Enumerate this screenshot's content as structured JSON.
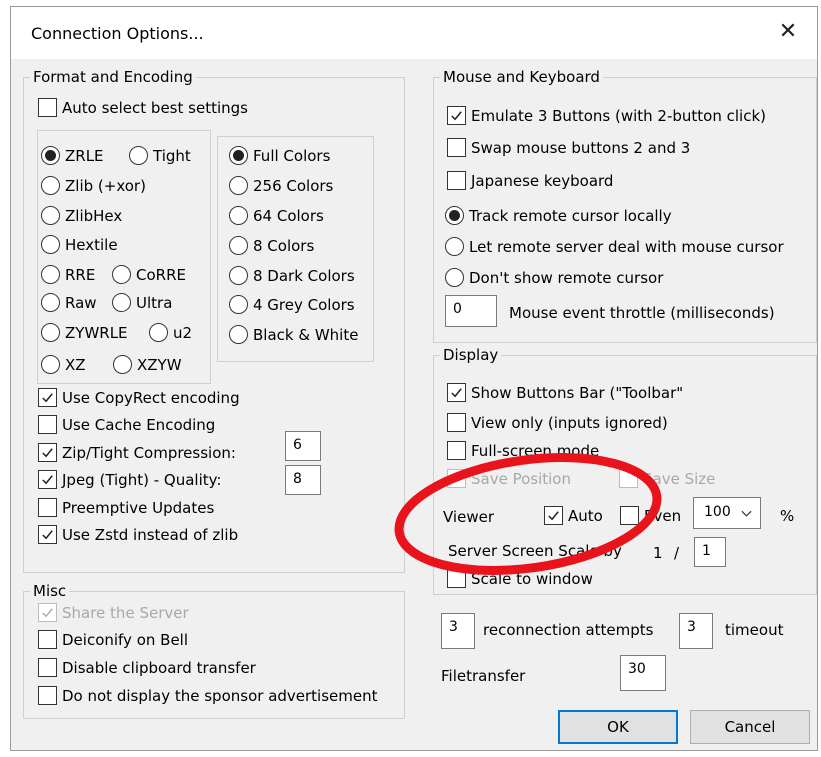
{
  "window": {
    "title": "Connection Options...",
    "close_glyph": "✕"
  },
  "format": {
    "legend": "Format and Encoding",
    "auto_select": {
      "label": "Auto select best settings",
      "checked": false
    },
    "encodings": [
      {
        "label": "ZRLE",
        "selected": true
      },
      {
        "label": "Tight",
        "selected": false
      },
      {
        "label": "Zlib (+xor)",
        "selected": false
      },
      {
        "label": "ZlibHex",
        "selected": false
      },
      {
        "label": "Hextile",
        "selected": false
      },
      {
        "label": "RRE",
        "selected": false
      },
      {
        "label": "CoRRE",
        "selected": false
      },
      {
        "label": "Raw",
        "selected": false
      },
      {
        "label": "Ultra",
        "selected": false
      },
      {
        "label": "ZYWRLE",
        "selected": false
      },
      {
        "label": "u2",
        "selected": false
      },
      {
        "label": "XZ",
        "selected": false
      },
      {
        "label": "XZYW",
        "selected": false
      }
    ],
    "colors": [
      {
        "label": "Full Colors",
        "selected": true
      },
      {
        "label": "256 Colors",
        "selected": false
      },
      {
        "label": "64 Colors",
        "selected": false
      },
      {
        "label": "8 Colors",
        "selected": false
      },
      {
        "label": "8 Dark Colors",
        "selected": false
      },
      {
        "label": "4 Grey Colors",
        "selected": false
      },
      {
        "label": "Black & White",
        "selected": false
      }
    ],
    "use_copyrect": {
      "label": "Use CopyRect encoding",
      "checked": true
    },
    "use_cache": {
      "label": "Use Cache Encoding",
      "checked": false
    },
    "zip_tight": {
      "label": "Zip/Tight Compression:",
      "checked": true,
      "value": "6"
    },
    "jpeg": {
      "label": "Jpeg (Tight) - Quality:",
      "checked": true,
      "value": "8"
    },
    "preemptive": {
      "label": "Preemptive Updates",
      "checked": false
    },
    "zstd": {
      "label": "Use Zstd instead of zlib",
      "checked": true
    }
  },
  "misc": {
    "legend": "Misc",
    "share": {
      "label": "Share the Server",
      "checked": true,
      "disabled": true
    },
    "deiconify": {
      "label": "Deiconify on Bell",
      "checked": false
    },
    "disable_clipboard": {
      "label": "Disable clipboard transfer",
      "checked": false
    },
    "no_sponsor": {
      "label": "Do not display the sponsor advertisement",
      "checked": false
    }
  },
  "mouse": {
    "legend": "Mouse and Keyboard",
    "emulate3": {
      "label": "Emulate 3 Buttons (with 2-button click)",
      "checked": true
    },
    "swap": {
      "label": "Swap mouse buttons 2 and 3",
      "checked": false
    },
    "japanese": {
      "label": "Japanese keyboard",
      "checked": false
    },
    "track_local": {
      "label": "Track remote cursor locally",
      "selected": true
    },
    "let_remote": {
      "label": "Let remote server deal with mouse cursor",
      "selected": false
    },
    "dont_show": {
      "label": "Don't show remote cursor",
      "selected": false
    },
    "throttle": {
      "value": "0",
      "label": "Mouse event throttle (milliseconds)"
    }
  },
  "display": {
    "legend": "Display",
    "show_toolbar": {
      "label": "Show Buttons Bar (\"Toolbar\"",
      "checked": true
    },
    "view_only": {
      "label": "View only (inputs ignored)",
      "checked": false
    },
    "fullscreen": {
      "label": "Full-screen mode",
      "checked": false
    },
    "save_position": {
      "label": "Save Position",
      "checked": false,
      "disabled": true
    },
    "save_size": {
      "label": "Save Size",
      "checked": false,
      "disabled": true
    },
    "viewer_label": "Viewer",
    "auto": {
      "label": "Auto",
      "checked": true
    },
    "even": {
      "label": "Even",
      "checked": false
    },
    "zoom": {
      "value": "100",
      "unit": "%"
    },
    "server_scale": {
      "label": "Server Screen Scale by",
      "numerator": "1",
      "slash": "/",
      "denominator": "1"
    },
    "scale_to_window": {
      "label": "Scale to window",
      "checked": false
    }
  },
  "reconnect": {
    "attempts": "3",
    "attempts_label": "reconnection attempts",
    "timeout": "3",
    "timeout_label": "timeout"
  },
  "filetransfer": {
    "label": "Filetransfer",
    "value": "30"
  },
  "buttons": {
    "ok": "OK",
    "cancel": "Cancel"
  },
  "annotation": {
    "color": "#e8131b",
    "shape": "ellipse"
  }
}
